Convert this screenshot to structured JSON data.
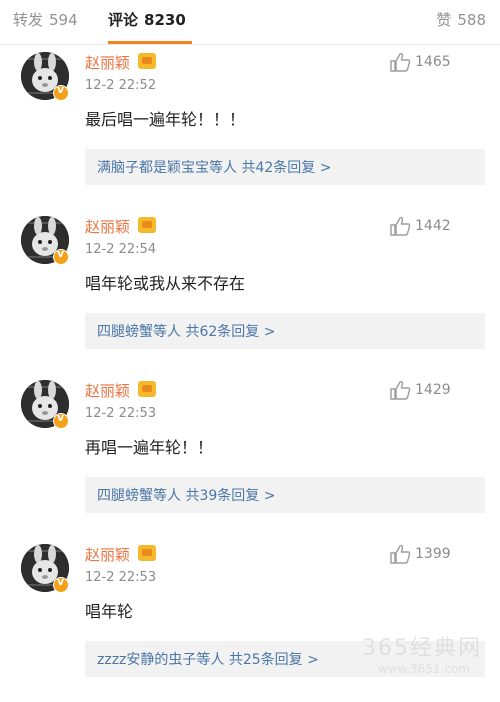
{
  "tabs": {
    "forward": {
      "label": "转发",
      "count": "594"
    },
    "comment": {
      "label": "评论",
      "count": "8230"
    },
    "like": {
      "label": "赞",
      "count": "588"
    }
  },
  "comments": [
    {
      "name": "赵丽颖",
      "time": "12-2 22:52",
      "likes": "1465",
      "text": "最后唱一遍年轮！！！",
      "reply": "满脑子都是颖宝宝等人  共42条回复 >"
    },
    {
      "name": "赵丽颖",
      "time": "12-2 22:54",
      "likes": "1442",
      "text": "唱年轮或我从来不存在",
      "reply": "四腿螃蟹等人  共62条回复 >"
    },
    {
      "name": "赵丽颖",
      "time": "12-2 22:53",
      "likes": "1429",
      "text": "再唱一遍年轮！！",
      "reply": "四腿螃蟹等人  共39条回复 >"
    },
    {
      "name": "赵丽颖",
      "time": "12-2 22:53",
      "likes": "1399",
      "text": "唱年轮",
      "reply": "zzzz安静的虫子等人  共25条回复 >"
    }
  ],
  "watermark": {
    "line1": "365经典网",
    "line2": "www.3651.com"
  }
}
